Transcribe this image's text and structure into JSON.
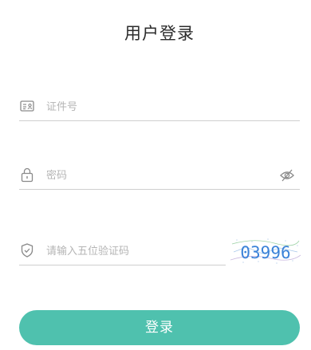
{
  "page": {
    "title": "用户登录"
  },
  "form": {
    "id_field": {
      "placeholder": "证件号",
      "icon": "id-card-icon"
    },
    "password_field": {
      "placeholder": "密码",
      "icon": "lock-icon",
      "toggle_icon": "eye-hidden-icon"
    },
    "captcha_field": {
      "placeholder": "请输入五位验证码",
      "icon": "shield-check-icon"
    },
    "captcha_image": {
      "code": "03996"
    },
    "submit_label": "登录"
  },
  "colors": {
    "accent": "#4fc1ae",
    "placeholder": "#b5b5b5",
    "divider": "#cfcfcf",
    "captcha_text": "#3b82d8"
  }
}
